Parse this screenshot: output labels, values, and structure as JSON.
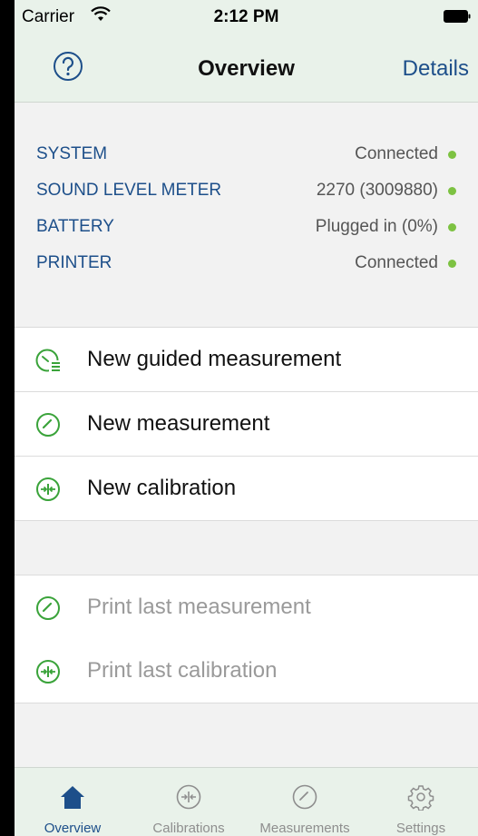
{
  "statusbar": {
    "carrier": "Carrier",
    "time": "2:12 PM"
  },
  "navbar": {
    "title": "Overview",
    "details_label": "Details",
    "help_icon": "question-circle-icon"
  },
  "system_status": [
    {
      "label": "SYSTEM",
      "value": "Connected",
      "status_color": "#7dc242"
    },
    {
      "label": "SOUND LEVEL METER",
      "value": "2270 (3009880)",
      "status_color": "#7dc242"
    },
    {
      "label": "BATTERY",
      "value": "Plugged in (0%)",
      "status_color": "#7dc242"
    },
    {
      "label": "PRINTER",
      "value": "Connected",
      "status_color": "#7dc242"
    }
  ],
  "actions": [
    {
      "label": "New guided measurement",
      "icon": "guided-measurement-icon"
    },
    {
      "label": "New measurement",
      "icon": "gauge-icon"
    },
    {
      "label": "New calibration",
      "icon": "calibration-icon"
    }
  ],
  "print_actions": [
    {
      "label": "Print last measurement",
      "icon": "gauge-icon"
    },
    {
      "label": "Print last calibration",
      "icon": "calibration-icon"
    }
  ],
  "tabs": [
    {
      "label": "Overview",
      "icon": "home-icon",
      "active": true
    },
    {
      "label": "Calibrations",
      "icon": "calibration-icon",
      "active": false
    },
    {
      "label": "Measurements",
      "icon": "gauge-icon",
      "active": false
    },
    {
      "label": "Settings",
      "icon": "gear-icon",
      "active": false
    }
  ],
  "colors": {
    "accent": "#1d4f8a",
    "icon_green": "#3aa33a",
    "bar_background": "#e9f2ea"
  }
}
